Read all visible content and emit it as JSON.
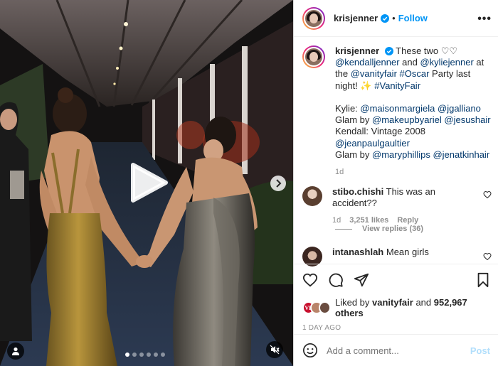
{
  "post": {
    "username": "krisjenner",
    "follow_label": "Follow",
    "more_label": "•••"
  },
  "caption": {
    "username": "krisjenner",
    "line1": "These two ♡♡",
    "mention1": "@kendalljenner",
    "and": " and ",
    "mention2": "@kyliejenner",
    "at_the": " at the ",
    "mention3": "@vanityfair",
    "hashtag1": "#Oscar",
    "party": " Party last night! ",
    "emoji": "✨",
    "hashtag2": "#VanityFair",
    "kylie_label": "Kylie: ",
    "kylie_m1": "@maisonmargiela",
    "kylie_m2": "@jgalliano",
    "glam_by": "Glam by ",
    "glam1_m1": "@makeupbyariel",
    "glam1_m2": "@jesushair",
    "kendall_label": "Kendall: Vintage 2008",
    "kendall_m1": "@jeanpaulgaultier",
    "glam2_m1": "@maryphillips",
    "glam2_m2": "@jenatkinhair",
    "time": "1d"
  },
  "comments": [
    {
      "username": "stibo.chishi",
      "text": "This was an accident??",
      "time": "1d",
      "likes": "3,251 likes",
      "reply": "Reply"
    },
    {
      "username": "intanashlah",
      "text": "Mean girls"
    }
  ],
  "view_replies": "View replies (36)",
  "likes": {
    "liked_by": "Liked by ",
    "user": "vanityfair",
    "and": " and ",
    "count": "952,967 others"
  },
  "timestamp": "1 DAY AGO",
  "add_comment": {
    "placeholder": "Add a comment...",
    "post_label": "Post"
  },
  "carousel": {
    "total_slides": 6,
    "active_slide": 1
  },
  "colors": {
    "accent": "#0095f6",
    "link": "#00376b",
    "muted": "#8e8e8e",
    "post_disabled": "#b2dffc"
  },
  "icons": [
    "play-icon",
    "chevron-right-icon",
    "user-tag-icon",
    "mute-icon",
    "heart-icon",
    "comment-icon",
    "share-icon",
    "bookmark-icon",
    "emoji-icon",
    "verified-icon"
  ]
}
